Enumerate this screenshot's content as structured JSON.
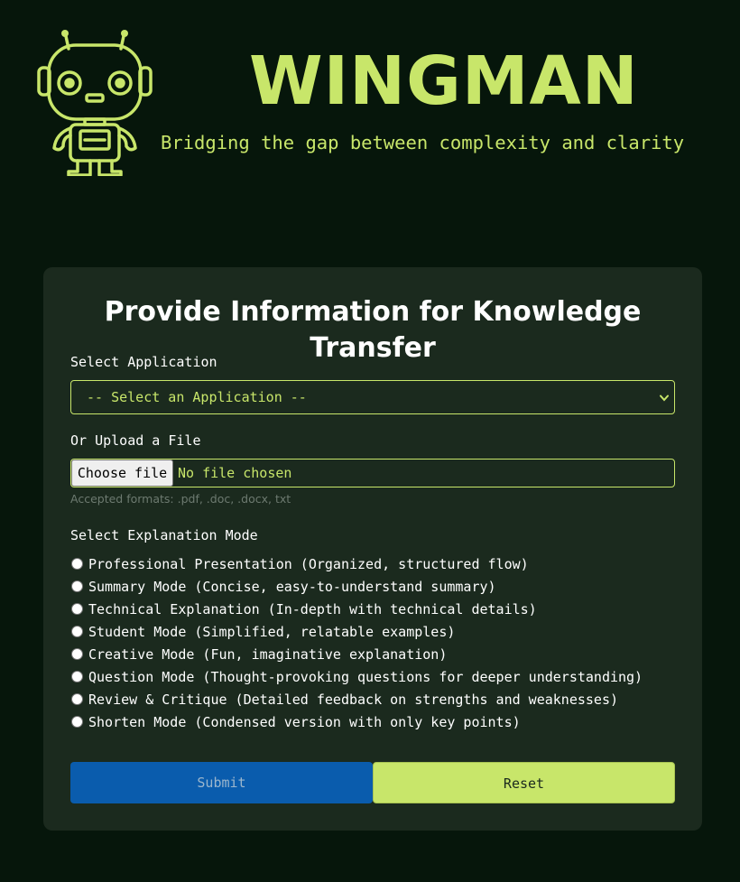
{
  "brand": {
    "title": "WINGMAN",
    "tagline": "Bridging the gap between complexity and clarity",
    "logo_icon": "robot-icon",
    "accent_color": "#c8e66a"
  },
  "form": {
    "title": "Provide Information for Knowledge Transfer",
    "application": {
      "label": "Select Application",
      "selected": "-- Select an Application --"
    },
    "upload": {
      "label": "Or Upload a File",
      "button_label": "Choose file",
      "status": "No file chosen",
      "hint": "Accepted formats: .pdf, .doc, .docx, txt"
    },
    "modes": {
      "label": "Select Explanation Mode",
      "options": [
        "Professional Presentation (Organized, structured flow)",
        "Summary Mode (Concise, easy-to-understand summary)",
        "Technical Explanation (In-depth with technical details)",
        "Student Mode (Simplified, relatable examples)",
        "Creative Mode (Fun, imaginative explanation)",
        "Question Mode (Thought-provoking questions for deeper understanding)",
        "Review & Critique (Detailed feedback on strengths and weaknesses)",
        "Shorten Mode (Condensed version with only key points)"
      ]
    },
    "submit_label": "Submit",
    "reset_label": "Reset",
    "submit_color": "#0a5cad"
  }
}
